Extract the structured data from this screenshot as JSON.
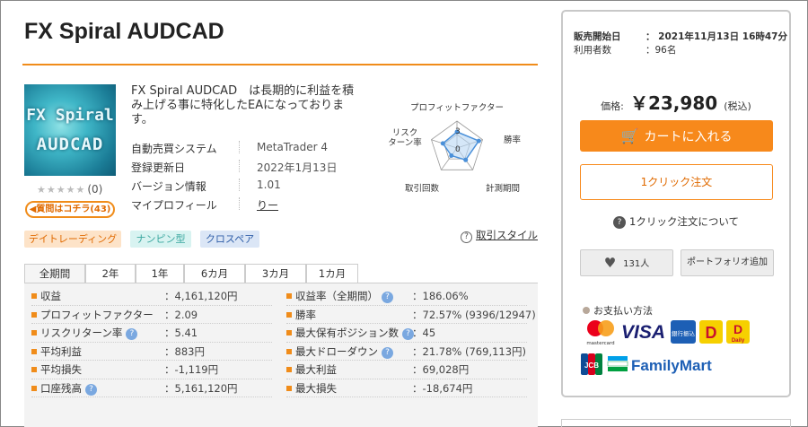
{
  "product": {
    "title": "FX Spiral AUDCAD",
    "thumb_line1": "FX Spiral",
    "thumb_line2": "AUDCAD",
    "stars": "★★★★★",
    "review_count": "(0)",
    "question_badge": "◀質問はコチラ(43)",
    "description": "FX Spiral AUDCAD　は長期的に利益を積み上げる事に特化したEAになっております。",
    "info": [
      {
        "label": "自動売買システム",
        "value": "MetaTrader 4"
      },
      {
        "label": "登録更新日",
        "value": "2022年1月13日"
      },
      {
        "label": "バージョン情報",
        "value": "1.01"
      },
      {
        "label": "マイプロフィール",
        "value": "りー"
      }
    ]
  },
  "radar": {
    "labels": {
      "profit_factor": "プロフィットファクター",
      "win_rate": "勝率",
      "period": "計測期間",
      "trades": "取引回数",
      "risk_return": "リスク\nターン率"
    },
    "scale_labels": [
      "3",
      "0"
    ],
    "values": {
      "profit_factor": 0.6,
      "win_rate": 0.85,
      "period": 0.55,
      "trades": 0.35,
      "risk_return": 0.55
    },
    "fill_color": "#b9d7f3",
    "line_color": "#4a90d9"
  },
  "tags": [
    "デイトレーディング",
    "ナンピン型",
    "クロスペア"
  ],
  "risk_style_label": "取引スタイル",
  "tabs": [
    "全期間",
    "2年",
    "1年",
    "6カ月",
    "3カ月",
    "1カ月"
  ],
  "stats_left": [
    {
      "label": "収益",
      "value": "：4,161,120円",
      "help": false
    },
    {
      "label": "プロフィットファクター",
      "value": "：2.09",
      "help": false
    },
    {
      "label": "リスクリターン率",
      "value": "：5.41",
      "help": true
    },
    {
      "label": "平均利益",
      "value": "：883円",
      "help": false
    },
    {
      "label": "平均損失",
      "value": "：-1,119円",
      "help": false
    },
    {
      "label": "口座残高",
      "value": "：5,161,120円",
      "help": true
    },
    {
      "label": "",
      "value": "",
      "help": false
    }
  ],
  "stats_right": [
    {
      "label": "収益率（全期間）",
      "value": "：186.06%",
      "help": true
    },
    {
      "label": "勝率",
      "value": "：72.57% (9396/12947)",
      "help": false
    },
    {
      "label": "最大保有ポジション数",
      "value": "：45",
      "help": true
    },
    {
      "label": "最大ドローダウン",
      "value": "：21.78% (769,113円)",
      "help": true
    },
    {
      "label": "最大利益",
      "value": "：69,028円",
      "help": false
    },
    {
      "label": "最大損失",
      "value": "：-18,674円",
      "help": false
    }
  ],
  "sidebar": {
    "sale_start_label": "販売開始日",
    "sale_start_value": "：  2021年11月13日 16時47分",
    "users_label": "利用者数",
    "users_value": "：96名",
    "price_label": "価格:",
    "price_value": "￥23,980",
    "price_tax": "(税込)",
    "cart_label": "カートに入れる",
    "oneclick_label": "1クリック注文",
    "about_oneclick": "1クリック注文について",
    "favorites_count": "131人",
    "portfolio_label": "ポートフォリオ追加",
    "payment_title": "お支払い方法",
    "payment_marks": {
      "mastercard_text": "mastercard",
      "visa": "VISA",
      "bank": "銀行振込",
      "daily_yamazaki": "Daily",
      "jcb": "JCB",
      "familymart": "FamilyMart"
    }
  },
  "colors": {
    "accent": "#f7891b",
    "title_rule": "#f08c1a"
  }
}
